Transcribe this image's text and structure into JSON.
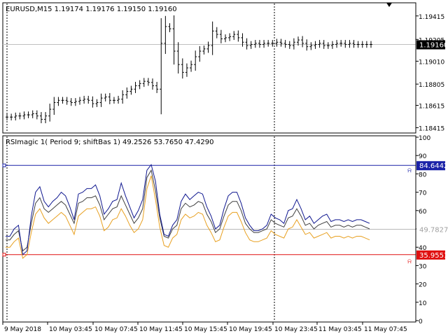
{
  "price_chart": {
    "header": "EURUSD,M15  1.19174 1.19176 1.19150 1.19160",
    "price_labels": [
      "1.19415",
      "1.19205",
      "1.19010",
      "1.18805",
      "1.18615",
      "1.18415"
    ],
    "price_values": [
      1.19415,
      1.19205,
      1.1901,
      1.18805,
      1.18615,
      1.18415
    ],
    "current_price_label": "1.19160",
    "current_price": 1.1916,
    "bid_line_color": "#c0c0c0",
    "up_down_candle_color": "#000000"
  },
  "indicator": {
    "header": "RSImagic 1( Period  9; shiftBas 1) 49.2526 53.7650 47.4290",
    "scale_labels": [
      "100",
      "90",
      "80",
      "70",
      "60",
      "50",
      "40",
      "30",
      "20",
      "10",
      "0"
    ],
    "scale_values": [
      100,
      90,
      80,
      70,
      60,
      50,
      40,
      30,
      20,
      10,
      0
    ],
    "upper_level": {
      "label": "84.6442",
      "value": 84.6442,
      "color": "#1a22a8"
    },
    "middle_level": {
      "label": "49.7827",
      "value": 49.7827,
      "color": "#b4b4b4"
    },
    "lower_level": {
      "label": "35.9551",
      "value": 35.9551,
      "color": "#e01010"
    },
    "series_colors": {
      "rsi": "#101890",
      "basis": "#404040",
      "signal": "#e8a020"
    }
  },
  "time_axis": {
    "labels": [
      "9 May 2018",
      "10 May 03:45",
      "10 May 07:45",
      "10 May 11:45",
      "10 May 15:45",
      "10 May 19:45",
      "10 May 23:45",
      "11 May 03:45",
      "11 May 07:45"
    ]
  },
  "chart_data": {
    "type": "line",
    "title": "",
    "xlabel": "",
    "ylabel": "",
    "x": [
      0,
      1,
      2,
      3,
      4,
      5,
      6,
      7,
      8,
      9,
      10,
      11,
      12,
      13,
      14,
      15,
      16,
      17,
      18,
      19,
      20,
      21,
      22,
      23,
      24,
      25,
      26,
      27,
      28,
      29,
      30,
      31,
      32,
      33,
      34,
      35,
      36,
      37,
      38,
      39,
      40,
      41,
      42,
      43,
      44,
      45,
      46,
      47,
      48,
      49,
      50,
      51,
      52,
      53,
      54,
      55,
      56,
      57,
      58,
      59,
      60,
      61,
      62,
      63,
      64,
      65,
      66,
      67,
      68,
      69,
      70,
      71,
      72,
      73,
      74,
      75,
      76,
      77,
      78,
      79,
      80,
      81,
      82,
      83,
      84,
      85
    ],
    "price_close": [
      1.1851,
      1.1851,
      1.1852,
      1.1852,
      1.1853,
      1.1853,
      1.1854,
      1.1852,
      1.1849,
      1.1852,
      1.1858,
      1.1864,
      1.1866,
      1.1866,
      1.1865,
      1.1864,
      1.1865,
      1.1866,
      1.1867,
      1.1866,
      1.1863,
      1.1864,
      1.1868,
      1.1869,
      1.1866,
      1.1866,
      1.1867,
      1.1871,
      1.1874,
      1.1876,
      1.1879,
      1.1881,
      1.1883,
      1.1882,
      1.1879,
      1.1876,
      1.1917,
      1.1932,
      1.193,
      1.191,
      1.1898,
      1.1891,
      1.1895,
      1.1898,
      1.1905,
      1.191,
      1.1912,
      1.1915,
      1.1928,
      1.1925,
      1.1921,
      1.1922,
      1.1923,
      1.1925,
      1.1922,
      1.1918,
      1.1915,
      1.1916,
      1.1917,
      1.1916,
      1.1917,
      1.1917,
      1.1917,
      1.1918,
      1.1917,
      1.1916,
      1.1915,
      1.1918,
      1.192,
      1.1917,
      1.1914,
      1.1915,
      1.1916,
      1.1917,
      1.1915,
      1.1915,
      1.1916,
      1.1917,
      1.1917,
      1.1916,
      1.1917,
      1.1916,
      1.1916,
      1.1916,
      1.1916,
      1.1916
    ],
    "series": [
      {
        "values": [
          46,
          46,
          50,
          52,
          36,
          38,
          57,
          70,
          73,
          65,
          62,
          65,
          67,
          70,
          68,
          62,
          55,
          69,
          70,
          72,
          72,
          74,
          68,
          58,
          61,
          65,
          66,
          75,
          68,
          62,
          56,
          60,
          66,
          82,
          85,
          76,
          58,
          47,
          46,
          52,
          55,
          65,
          69,
          66,
          68,
          70,
          69,
          62,
          57,
          50,
          52,
          61,
          68,
          70,
          70,
          64,
          56,
          52,
          49,
          49,
          50,
          52,
          58,
          56,
          55,
          53,
          60,
          61,
          66,
          61,
          55,
          57,
          53,
          55,
          57,
          58,
          54,
          55,
          55,
          54,
          55,
          54,
          55,
          55,
          54,
          53
        ]
      },
      {
        "values": [
          44,
          44,
          47,
          49,
          38,
          40,
          53,
          64,
          67,
          61,
          59,
          61,
          63,
          65,
          63,
          58,
          53,
          64,
          65,
          67,
          67,
          68,
          63,
          55,
          58,
          61,
          62,
          68,
          63,
          58,
          53,
          56,
          61,
          78,
          82,
          71,
          56,
          46,
          45,
          50,
          52,
          61,
          64,
          62,
          63,
          65,
          64,
          58,
          54,
          48,
          50,
          57,
          63,
          65,
          65,
          60,
          53,
          50,
          48,
          48,
          49,
          50,
          55,
          53,
          52,
          51,
          56,
          57,
          61,
          57,
          52,
          53,
          50,
          52,
          53,
          54,
          51,
          52,
          52,
          51,
          52,
          51,
          52,
          52,
          51,
          50
        ]
      },
      {
        "values": [
          40,
          40,
          43,
          45,
          34,
          36,
          48,
          58,
          61,
          56,
          53,
          55,
          57,
          59,
          57,
          52,
          47,
          57,
          59,
          61,
          61,
          62,
          57,
          49,
          51,
          55,
          56,
          61,
          57,
          52,
          48,
          50,
          55,
          72,
          79,
          66,
          51,
          41,
          40,
          45,
          47,
          55,
          58,
          56,
          57,
          59,
          58,
          52,
          48,
          43,
          44,
          51,
          57,
          59,
          59,
          54,
          48,
          44,
          43,
          43,
          44,
          45,
          49,
          47,
          46,
          45,
          50,
          51,
          55,
          51,
          47,
          48,
          45,
          46,
          47,
          48,
          45,
          46,
          46,
          45,
          46,
          45,
          46,
          46,
          45,
          44
        ]
      }
    ],
    "yrange_price": [
      1.1838,
      1.1952
    ],
    "yrange_indicator": [
      0,
      100
    ],
    "grid": false,
    "legend": "none"
  }
}
